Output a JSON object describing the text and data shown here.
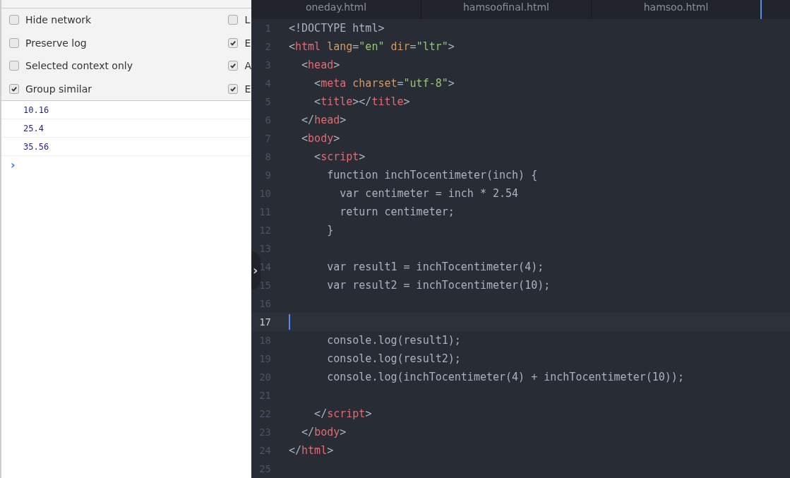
{
  "console_settings": {
    "left": [
      {
        "label": "Hide network",
        "checked": false
      },
      {
        "label": "Preserve log",
        "checked": false
      },
      {
        "label": "Selected context only",
        "checked": false
      },
      {
        "label": "Group similar",
        "checked": true
      }
    ],
    "right": [
      {
        "label": "L",
        "checked": false
      },
      {
        "label": "E",
        "checked": true
      },
      {
        "label": "A",
        "checked": true
      },
      {
        "label": "E",
        "checked": true
      }
    ]
  },
  "console_messages": [
    "10.16",
    "25.4",
    "35.56"
  ],
  "console_prompt": "›",
  "editor": {
    "tabs": [
      {
        "label": "oneday.html",
        "selected": false
      },
      {
        "label": "hamsoofinal.html",
        "selected": false
      },
      {
        "label": "hamsoo.html",
        "selected": true
      }
    ],
    "toggle": "›",
    "lines": [
      {
        "number": "1",
        "current": false,
        "tokens": [
          {
            "kind": "plain",
            "text": "<!DOCTYPE html>"
          }
        ]
      },
      {
        "number": "2",
        "current": false,
        "tokens": [
          {
            "kind": "plain",
            "text": "<"
          },
          {
            "kind": "tag",
            "text": "html"
          },
          {
            "kind": "attr",
            "text": " lang"
          },
          {
            "kind": "plain",
            "text": "="
          },
          {
            "kind": "string",
            "text": "\"en\""
          },
          {
            "kind": "attr",
            "text": " dir"
          },
          {
            "kind": "plain",
            "text": "="
          },
          {
            "kind": "string",
            "text": "\"ltr\""
          },
          {
            "kind": "plain",
            "text": ">"
          }
        ]
      },
      {
        "number": "3",
        "current": false,
        "tokens": [
          {
            "kind": "plain",
            "text": "  <"
          },
          {
            "kind": "tag",
            "text": "head"
          },
          {
            "kind": "plain",
            "text": ">"
          }
        ]
      },
      {
        "number": "4",
        "current": false,
        "tokens": [
          {
            "kind": "plain",
            "text": "    <"
          },
          {
            "kind": "tag",
            "text": "meta"
          },
          {
            "kind": "attr",
            "text": " charset"
          },
          {
            "kind": "plain",
            "text": "="
          },
          {
            "kind": "string",
            "text": "\"utf-8\""
          },
          {
            "kind": "plain",
            "text": ">"
          }
        ]
      },
      {
        "number": "5",
        "current": false,
        "tokens": [
          {
            "kind": "plain",
            "text": "    <"
          },
          {
            "kind": "tag",
            "text": "title"
          },
          {
            "kind": "plain",
            "text": "></"
          },
          {
            "kind": "tag",
            "text": "title"
          },
          {
            "kind": "plain",
            "text": ">"
          }
        ]
      },
      {
        "number": "6",
        "current": false,
        "tokens": [
          {
            "kind": "plain",
            "text": "  </"
          },
          {
            "kind": "tag",
            "text": "head"
          },
          {
            "kind": "plain",
            "text": ">"
          }
        ]
      },
      {
        "number": "7",
        "current": false,
        "tokens": [
          {
            "kind": "plain",
            "text": "  <"
          },
          {
            "kind": "tag",
            "text": "body"
          },
          {
            "kind": "plain",
            "text": ">"
          }
        ]
      },
      {
        "number": "8",
        "current": false,
        "tokens": [
          {
            "kind": "plain",
            "text": "    <"
          },
          {
            "kind": "tag",
            "text": "script"
          },
          {
            "kind": "plain",
            "text": ">"
          }
        ]
      },
      {
        "number": "9",
        "current": false,
        "tokens": [
          {
            "kind": "plain",
            "text": "      function inchTocentimeter(inch) {"
          }
        ]
      },
      {
        "number": "10",
        "current": false,
        "tokens": [
          {
            "kind": "plain",
            "text": "        var centimeter = inch * 2.54"
          }
        ]
      },
      {
        "number": "11",
        "current": false,
        "tokens": [
          {
            "kind": "plain",
            "text": "        return centimeter;"
          }
        ]
      },
      {
        "number": "12",
        "current": false,
        "tokens": [
          {
            "kind": "plain",
            "text": "      }"
          }
        ]
      },
      {
        "number": "13",
        "current": false
      },
      {
        "number": "14",
        "current": false,
        "tokens": [
          {
            "kind": "plain",
            "text": "      var result1 = inchTocentimeter(4);"
          }
        ]
      },
      {
        "number": "15",
        "current": false,
        "tokens": [
          {
            "kind": "plain",
            "text": "      var result2 = inchTocentimeter(10);"
          }
        ]
      },
      {
        "number": "16",
        "current": false
      },
      {
        "number": "17",
        "current": true
      },
      {
        "number": "18",
        "current": false,
        "tokens": [
          {
            "kind": "plain",
            "text": "      console.log(result1);"
          }
        ]
      },
      {
        "number": "19",
        "current": false,
        "tokens": [
          {
            "kind": "plain",
            "text": "      console.log(result2);"
          }
        ]
      },
      {
        "number": "20",
        "current": false,
        "tokens": [
          {
            "kind": "plain",
            "text": "      console.log(inchTocentimeter(4) + inchTocentimeter(10));"
          }
        ]
      },
      {
        "number": "21",
        "current": false
      },
      {
        "number": "22",
        "current": false,
        "tokens": [
          {
            "kind": "plain",
            "text": "    </"
          },
          {
            "kind": "tag",
            "text": "script"
          },
          {
            "kind": "plain",
            "text": ">"
          }
        ]
      },
      {
        "number": "23",
        "current": false,
        "tokens": [
          {
            "kind": "plain",
            "text": "  </"
          },
          {
            "kind": "tag",
            "text": "body"
          },
          {
            "kind": "plain",
            "text": ">"
          }
        ]
      },
      {
        "number": "24",
        "current": false,
        "tokens": [
          {
            "kind": "plain",
            "text": "</"
          },
          {
            "kind": "tag",
            "text": "html"
          },
          {
            "kind": "plain",
            "text": ">"
          }
        ]
      },
      {
        "number": "25",
        "current": false
      }
    ]
  }
}
